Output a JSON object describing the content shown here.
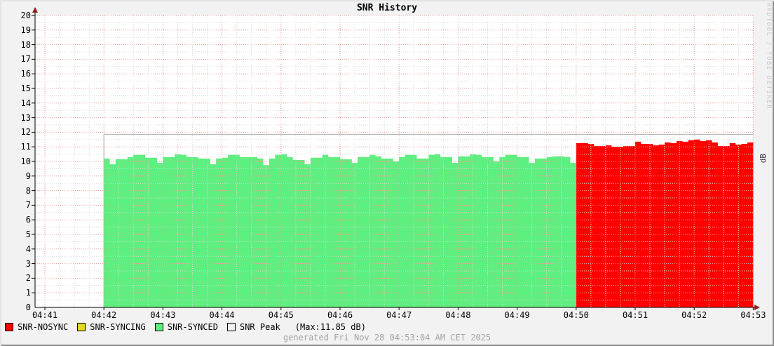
{
  "header": {
    "title": "SNR History"
  },
  "watermark": "RRDTOOL / TOBI OETIKER",
  "right_axis_label": "dB",
  "footer": {
    "generated": "generated Fri Nov 28 04:53:04 AM CET 2025"
  },
  "legend": {
    "items": [
      {
        "label": "SNR-NOSYNC",
        "color": "#ff0000"
      },
      {
        "label": "SNR-SYNCING",
        "color": "#e3d62b"
      },
      {
        "label": "SNR-SYNCED",
        "color": "#5fee7f"
      },
      {
        "label": "SNR Peak",
        "color": "#efefef"
      }
    ],
    "max_note": "(Max:11.85 dB)"
  },
  "chart_data": {
    "type": "area",
    "title": "SNR History",
    "ylabel_right": "dB",
    "ylim": [
      0,
      20
    ],
    "y_tick_step": 1,
    "x_tick_labels": [
      "04:41",
      "04:42",
      "04:43",
      "04:44",
      "04:45",
      "04:46",
      "04:47",
      "04:48",
      "04:49",
      "04:50",
      "04:51",
      "04:52",
      "04:53"
    ],
    "x_minor_per_major": 4,
    "grid": {
      "major_color": "#f19c9c",
      "minor_color": "#dadada",
      "on": true
    },
    "legend_position": "bottom",
    "axis_color": "#000000",
    "arrow_color": "#8f1f1f",
    "canvas_color": "#ffffff",
    "peak": {
      "name": "SNR Peak",
      "value": 11.85,
      "color": "#b5b5b5",
      "start_minute": 1,
      "end_minute": 12
    },
    "series": [
      {
        "name": "SNR-SYNCED",
        "color": "#5fee7f",
        "start_minute": 1,
        "step_minutes": 0.1,
        "values": [
          10.2,
          9.8,
          10.15,
          10.15,
          10.3,
          10.45,
          10.45,
          10.25,
          10.25,
          9.9,
          10.3,
          10.3,
          10.5,
          10.45,
          10.3,
          10.3,
          10.2,
          10.2,
          9.8,
          10.2,
          10.25,
          10.45,
          10.45,
          10.3,
          10.3,
          10.3,
          10.2,
          9.75,
          10.2,
          10.45,
          10.5,
          10.3,
          10.1,
          10.1,
          9.8,
          10.25,
          10.25,
          10.45,
          10.3,
          10.3,
          10.15,
          10.15,
          9.9,
          10.3,
          10.3,
          10.45,
          10.35,
          10.2,
          10.2,
          10.0,
          10.3,
          10.45,
          10.45,
          10.2,
          10.2,
          10.45,
          10.5,
          10.3,
          10.3,
          9.9,
          10.35,
          10.35,
          10.5,
          10.45,
          10.3,
          10.3,
          10.0,
          10.3,
          10.45,
          10.45,
          10.3,
          10.3,
          9.9,
          10.2,
          10.2,
          10.3,
          10.35,
          10.35,
          10.3,
          9.9
        ]
      },
      {
        "name": "SNR-NOSYNC",
        "color": "#ff0000",
        "start_minute": 9,
        "step_minutes": 0.1,
        "values": [
          11.25,
          11.25,
          11.2,
          11.05,
          11.05,
          11.1,
          11.0,
          11.0,
          11.05,
          11.05,
          11.35,
          11.2,
          11.2,
          11.1,
          11.15,
          11.3,
          11.25,
          11.4,
          11.35,
          11.45,
          11.5,
          11.4,
          11.45,
          11.3,
          11.05,
          11.05,
          11.25,
          11.15,
          11.2,
          11.3
        ]
      }
    ]
  }
}
